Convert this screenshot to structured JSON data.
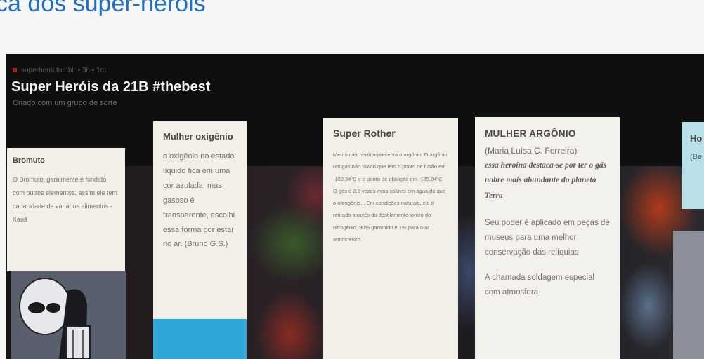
{
  "page": {
    "heading": "ca dos super-heróis"
  },
  "board": {
    "header_small": "superherói.tumblr  •  3h  •  1m",
    "title": "Super Heróis da 21B #thebest",
    "subtitle": "Criado com um grupo de sorte"
  },
  "cards": [
    {
      "title": "Bromuto",
      "text": "O Bromuto, garalmente é fundido com outros elementos, assim ele tem capacidade de variados alimentos - Kauã"
    },
    {
      "title": "Mulher oxigênio",
      "text": "o oxigênio no estado líquido fica em uma cor azulada, mas gasoso é transparente, escolhi essa forma por estar no ar. (Bruno G.S.)"
    },
    {
      "title": "Super Rother",
      "text": "Meu super herói representa o argônio. O argônio um gás não tóxico que tem o ponto de fusão em -189,34ºC e o ponto de ebulição em -185,84ºC. O gás é 2,5 vezes mais solúvel em água do que o nitrogênio... Em condições naturais, ele é retirado através do destilamento ionizo do nitrogênio, 90% garantido e 1% para o ar atmosférico."
    },
    {
      "title": "MULHER ARGÔNIO",
      "author": "(Maria Luísa C. Ferreira)",
      "description": "essa heroína destaca-se por ter o gás nobre mais abundante do planeta Terra",
      "power": "Seu poder é aplicado em peças de museus para uma melhor conservação das relíquias",
      "extra": "A chamada soldagem especial com atmosfera"
    },
    {
      "title": "Ho",
      "text": "(Be O c tóx mal"
    }
  ],
  "colors": {
    "heading_link": "#1f6fc5",
    "video_bg": "#0f0f10",
    "card_bg": "#f1efe8",
    "accent_strip": "#2ea7d8",
    "teal_card": "#b9e0e6",
    "avatar_bg": "#5a5f6d"
  }
}
